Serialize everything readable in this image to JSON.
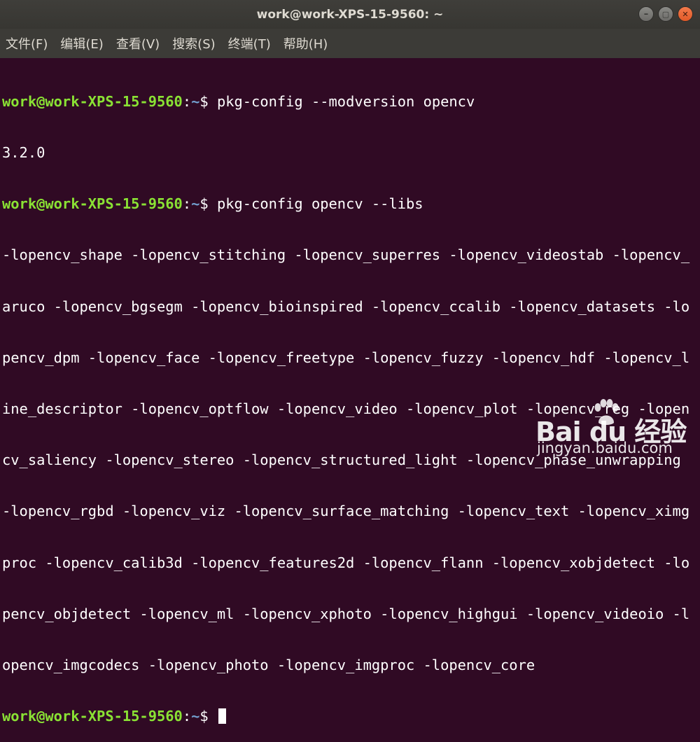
{
  "window": {
    "title": "work@work-XPS-15-9560: ~"
  },
  "window_controls": {
    "minimize": "–",
    "maximize": "▢",
    "close": "✕"
  },
  "menubar": {
    "items": [
      {
        "label": "文件(F)"
      },
      {
        "label": "编辑(E)"
      },
      {
        "label": "查看(V)"
      },
      {
        "label": "搜索(S)"
      },
      {
        "label": "终端(T)"
      },
      {
        "label": "帮助(H)"
      }
    ]
  },
  "terminal": {
    "prompt_user": "work@work-XPS-15-9560",
    "prompt_sep": ":",
    "prompt_path": "~",
    "prompt_symbol": "$ ",
    "command1": "pkg-config --modversion opencv",
    "output1": "3.2.0",
    "command2": "pkg-config opencv --libs",
    "output2_lines": [
      "-lopencv_shape -lopencv_stitching -lopencv_superres -lopencv_videostab -lopencv_",
      "aruco -lopencv_bgsegm -lopencv_bioinspired -lopencv_ccalib -lopencv_datasets -lo",
      "pencv_dpm -lopencv_face -lopencv_freetype -lopencv_fuzzy -lopencv_hdf -lopencv_l",
      "ine_descriptor -lopencv_optflow -lopencv_video -lopencv_plot -lopencv_reg -lopen",
      "cv_saliency -lopencv_stereo -lopencv_structured_light -lopencv_phase_unwrapping",
      "-lopencv_rgbd -lopencv_viz -lopencv_surface_matching -lopencv_text -lopencv_ximg",
      "proc -lopencv_calib3d -lopencv_features2d -lopencv_flann -lopencv_xobjdetect -lo",
      "pencv_objdetect -lopencv_ml -lopencv_xphoto -lopencv_highgui -lopencv_videoio -l",
      "opencv_imgcodecs -lopencv_photo -lopencv_imgproc -lopencv_core"
    ]
  },
  "watermark": {
    "logo_text": "Bai du 经验",
    "url": "jingyan.baidu.com"
  },
  "colors": {
    "terminal_bg": "#300a24",
    "prompt_user": "#8ae234",
    "prompt_path": "#729fcf",
    "text": "#ffffff",
    "titlebar_bg": "#3c3b37"
  }
}
